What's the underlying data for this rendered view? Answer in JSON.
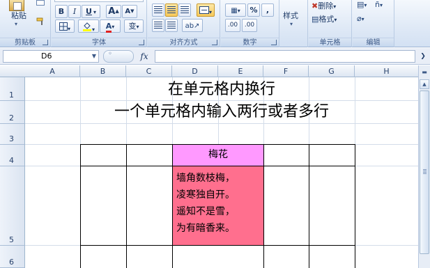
{
  "ribbon": {
    "clipboard": {
      "paste_label": "粘贴",
      "group_label": "剪贴板"
    },
    "font": {
      "bold": "B",
      "italic": "I",
      "underline": "U",
      "underline_arrow": "▾",
      "grow": "A",
      "shrink": "A",
      "fill_arrow": "▾",
      "color_glyph": "A",
      "color_arrow": "▾",
      "phonetic": "变",
      "group_label": "字体"
    },
    "alignment": {
      "group_label": "对齐方式"
    },
    "number": {
      "percent": "%",
      "comma": ",",
      "inc_decimal": ".00",
      "dec_decimal": ".00",
      "group_label": "数字"
    },
    "styles": {
      "label": "样式",
      "arrow": "▾"
    },
    "cells": {
      "delete_label": "删除",
      "format_label": "格式",
      "group_label": "单元格"
    },
    "editing": {
      "group_label": "编辑"
    }
  },
  "formula_bar": {
    "name_box": "D6",
    "fx": "fx",
    "value": ""
  },
  "columns": [
    "A",
    "B",
    "C",
    "D",
    "E",
    "F",
    "G",
    "H"
  ],
  "rows": [
    "1",
    "2",
    "3",
    "4",
    "5",
    "6"
  ],
  "content": {
    "title_line1": "在单元格内换行",
    "title_line2": "一个单元格内输入两行或者多行",
    "header_cell": "梅花",
    "poem": [
      "墙角数枝梅，",
      "凌寒独自开。",
      "遥知不是雪，",
      "为有暗香来。"
    ]
  },
  "colors": {
    "header_fill": "#ff99ff",
    "poem_fill": "#ff6f8e",
    "ribbon_bg": "#dfe9f6",
    "grid_line": "#d3dce9"
  }
}
